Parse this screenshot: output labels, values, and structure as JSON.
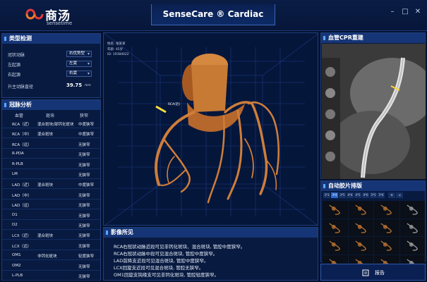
{
  "header": {
    "brand_cn": "商汤",
    "brand_en": "sensetime",
    "app_title": "SenseCare ® Cardiac"
  },
  "type_panel": {
    "title": "类型检测",
    "fields": [
      {
        "label": "冠状动脉",
        "value": "右优势型"
      },
      {
        "label": "左起源",
        "value": "左窦"
      },
      {
        "label": "右起源",
        "value": "右窦"
      }
    ],
    "aorta_label": "升主动脉直径",
    "aorta_value": "39.75",
    "aorta_unit": "mm"
  },
  "coronary_panel": {
    "title": "冠脉分析",
    "headers": [
      "血管",
      "斑块",
      "狭窄"
    ],
    "rows": [
      {
        "vessel": "RCA（近）",
        "plaque": "混合斑块/部钙化斑块",
        "stenosis": "中度狭窄"
      },
      {
        "vessel": "RCA（中）",
        "plaque": "混合斑块",
        "stenosis": "中度狭窄"
      },
      {
        "vessel": "RCA（远）",
        "plaque": "",
        "stenosis": "无狭窄"
      },
      {
        "vessel": "R-PDA",
        "plaque": "",
        "stenosis": "无狭窄"
      },
      {
        "vessel": "R-PLB",
        "plaque": "",
        "stenosis": "无狭窄"
      },
      {
        "vessel": "LM",
        "plaque": "",
        "stenosis": "无狭窄"
      },
      {
        "vessel": "LAD（近）",
        "plaque": "混合斑块",
        "stenosis": "中度狭窄"
      },
      {
        "vessel": "LAD（中）",
        "plaque": "",
        "stenosis": "无狭窄"
      },
      {
        "vessel": "LAD（远）",
        "plaque": "",
        "stenosis": "无狭窄"
      },
      {
        "vessel": "D1",
        "plaque": "",
        "stenosis": "无狭窄"
      },
      {
        "vessel": "D2",
        "plaque": "",
        "stenosis": "无狭窄"
      },
      {
        "vessel": "LCX（近）",
        "plaque": "混合斑块",
        "stenosis": "无狭窄"
      },
      {
        "vessel": "LCX（远）",
        "plaque": "",
        "stenosis": "无狭窄"
      },
      {
        "vessel": "OM1",
        "plaque": "非钙化斑块",
        "stenosis": "轻度狭窄"
      },
      {
        "vessel": "OM2",
        "plaque": "",
        "stenosis": "无狭窄"
      },
      {
        "vessel": "L-PLB",
        "plaque": "",
        "stenosis": "无狭窄"
      }
    ]
  },
  "viewer": {
    "patient_name": "姓名: 张某某",
    "patient_age": "年龄: 45岁",
    "patient_id": "ID: 19384022",
    "vessel_label": "RCA(近)"
  },
  "findings": {
    "title": "影像所见",
    "lines": [
      "RCA右冠状动脉近段可见非钙化斑块、混合斑块, 管腔中度狭窄。",
      "RCA右冠状动脉中段可见混合斑块, 管腔中度狭窄。",
      "LAD前降支近段可见混合斑块, 管腔中度狭窄。",
      "LCX回旋支近段可见混合斑块, 管腔无狭窄。",
      "OM1回旋支钝缘支可见非钙化斑块, 管腔轻度狭窄。"
    ]
  },
  "cpr_panel": {
    "title": "血管CPR重建"
  },
  "film_panel": {
    "title": "自动胶片排版",
    "tabs": [
      "3*3",
      "3*4",
      "3*5",
      "4*4",
      "4*5",
      "4*6",
      "5*5",
      "5*6"
    ]
  },
  "report_button": {
    "label": "报告"
  },
  "colors": {
    "accent": "#2b66c9",
    "vessel": "#c9773a",
    "panel_bg": "#081a40"
  }
}
